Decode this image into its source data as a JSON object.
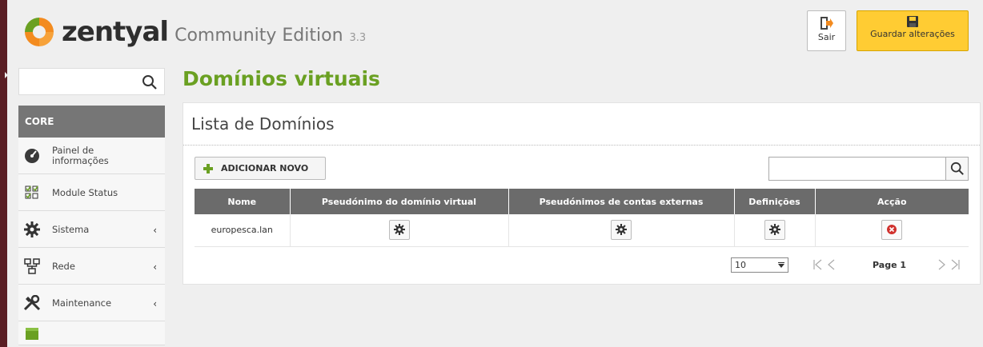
{
  "header": {
    "brand": "zentyal",
    "edition": "Community Edition",
    "version": "3.3",
    "logout_label": "Sair",
    "save_label": "Guardar alterações"
  },
  "sidebar": {
    "search_placeholder": "",
    "section": "CORE",
    "items": [
      {
        "label_line1": "Painel de",
        "label_line2": "informações",
        "icon": "dashboard-icon",
        "chevron": false
      },
      {
        "label": "Module Status",
        "icon": "module-status-icon",
        "chevron": false
      },
      {
        "label": "Sistema",
        "icon": "gear-icon",
        "chevron": true
      },
      {
        "label": "Rede",
        "icon": "network-icon",
        "chevron": true
      },
      {
        "label": "Maintenance",
        "icon": "tools-icon",
        "chevron": true
      }
    ]
  },
  "main": {
    "title": "Domínios virtuais",
    "panel_title": "Lista de Domínios",
    "add_label": "ADICIONAR NOVO",
    "table_search_value": "",
    "columns": [
      "Nome",
      "Pseudónimo do domínio virtual",
      "Pseudónimos de contas externas",
      "Definições",
      "Acção"
    ],
    "rows": [
      {
        "name": "europesca.lan"
      }
    ],
    "pager": {
      "page_size": "10",
      "page_label": "Page 1"
    }
  },
  "colors": {
    "accent_green": "#6aa022",
    "save_yellow": "#ffcc33",
    "left_bar": "#5a1e24",
    "table_header": "#6b6b6b",
    "delete_red": "#d0312d",
    "logo_orange": "#f38b1f"
  }
}
